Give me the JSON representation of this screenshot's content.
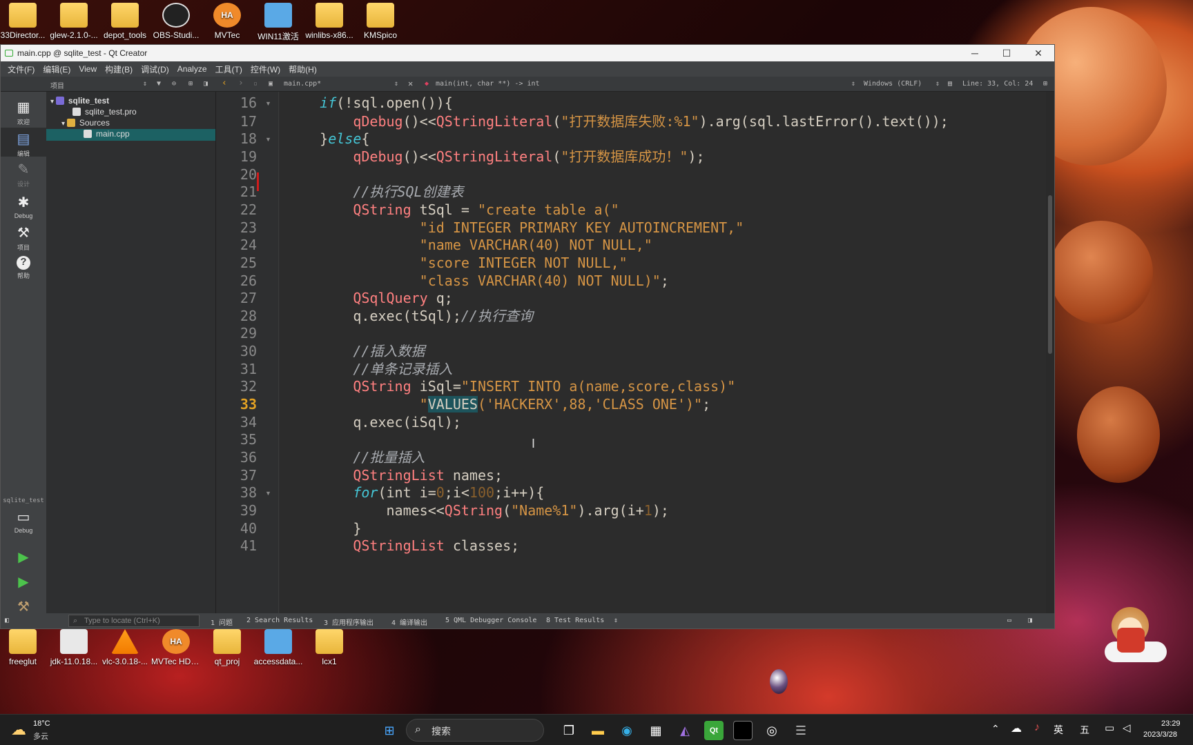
{
  "desktop": {
    "top_icons": [
      {
        "label": "33Director...",
        "icon": "folder-icon"
      },
      {
        "label": "glew-2.1.0-...",
        "icon": "zip-folder-icon"
      },
      {
        "label": "depot_tools",
        "icon": "folder-icon"
      },
      {
        "label": "OBS-Studi...",
        "icon": "obs-icon"
      },
      {
        "label": "MVTec",
        "icon": "halcon-icon",
        "badge": "HA"
      },
      {
        "label": "WIN11激活",
        "icon": "installer-icon"
      },
      {
        "label": "winlibs-x86...",
        "icon": "zip-folder-icon"
      },
      {
        "label": "KMSpico",
        "icon": "folder-icon"
      }
    ],
    "bottom_icons": [
      {
        "label": "freeglut",
        "icon": "folder-icon"
      },
      {
        "label": "jdk-11.0.18...",
        "icon": "java-icon"
      },
      {
        "label": "vlc-3.0.18-...",
        "icon": "vlc-icon"
      },
      {
        "label": "MVTec HDevel...",
        "icon": "halcon-icon",
        "badge": "HA"
      },
      {
        "label": "qt_proj",
        "icon": "folder-icon"
      },
      {
        "label": "accessdata...",
        "icon": "installer-icon"
      },
      {
        "label": "lcx1",
        "icon": "folder-icon"
      }
    ]
  },
  "window": {
    "title": "main.cpp @ sqlite_test - Qt Creator",
    "controls": {
      "minimize": "─",
      "maximize": "☐",
      "close": "✕"
    }
  },
  "menu": [
    "文件(F)",
    "编辑(E)",
    "View",
    "构建(B)",
    "调试(D)",
    "Analyze",
    "工具(T)",
    "控件(W)",
    "帮助(H)"
  ],
  "toolbar": {
    "panel_label": "项目",
    "file_tab": "main.cpp*",
    "function": "main(int, char **) -> int",
    "line_ending": "Windows (CRLF)",
    "cursor_pos": "Line: 33, Col: 24"
  },
  "modes": [
    {
      "label": "欢迎",
      "icon": "grid-icon"
    },
    {
      "label": "编辑",
      "icon": "edit-icon"
    },
    {
      "label": "设计",
      "icon": "pencil-icon"
    },
    {
      "label": "Debug",
      "icon": "bug-icon"
    },
    {
      "label": "项目",
      "icon": "wrench-icon"
    },
    {
      "label": "帮助",
      "icon": "help-icon"
    }
  ],
  "kit": {
    "project": "sqlite_test",
    "label": "Debug"
  },
  "project_tree": [
    {
      "label": "sqlite_test",
      "level": 0
    },
    {
      "label": "sqlite_test.pro",
      "level": 1
    },
    {
      "label": "Sources",
      "level": 1
    },
    {
      "label": "main.cpp",
      "level": 2,
      "selected": true
    }
  ],
  "editor": {
    "current_line": 33,
    "lines": [
      {
        "n": "16",
        "fold": true,
        "html": "    <span class='k'>if</span>(!sql.open()){"
      },
      {
        "n": "17",
        "html": "        <span class='fn'>qDebug</span>()&lt;&lt;<span class='fn'>QStringLiteral</span>(<span class='s'>\"打开数据库失败:%1\"</span>).arg(sql.lastError().text());"
      },
      {
        "n": "18",
        "fold": true,
        "html": "    }<span class='k'>else</span>{"
      },
      {
        "n": "19",
        "html": "        <span class='fn'>qDebug</span>()&lt;&lt;<span class='fn'>QStringLiteral</span>(<span class='s'>\"打开数据库成功！\"</span>);"
      },
      {
        "n": "20",
        "html": ""
      },
      {
        "n": "21",
        "html": "        <span class='c'>//执行SQL创建表</span>"
      },
      {
        "n": "22",
        "html": "        <span class='ty'>QString</span> tSql = <span class='s'>\"create table a(\"</span>"
      },
      {
        "n": "23",
        "html": "                <span class='s'>\"id INTEGER PRIMARY KEY AUTOINCREMENT,\"</span>"
      },
      {
        "n": "24",
        "html": "                <span class='s'>\"name VARCHAR(40) NOT NULL,\"</span>"
      },
      {
        "n": "25",
        "html": "                <span class='s'>\"score INTEGER NOT NULL,\"</span>"
      },
      {
        "n": "26",
        "html": "                <span class='s'>\"class VARCHAR(40) NOT NULL)\"</span>;"
      },
      {
        "n": "27",
        "html": "        <span class='ty'>QSqlQuery</span> q;"
      },
      {
        "n": "28",
        "html": "        q.exec(tSql);<span class='c'>//执行查询</span>"
      },
      {
        "n": "29",
        "html": ""
      },
      {
        "n": "30",
        "html": "        <span class='c'>//插入数据</span>"
      },
      {
        "n": "31",
        "html": "        <span class='c'>//单条记录插入</span>"
      },
      {
        "n": "32",
        "html": "        <span class='ty'>QString</span> iSql=<span class='s'>\"INSERT INTO a(name,score,class)\"</span>"
      },
      {
        "n": "33",
        "html": "                <span class='s'>\"<span class='hl'>VALUES</span>('HACKERX',88,'CLASS ONE')\"</span>;"
      },
      {
        "n": "34",
        "html": "        q.exec(iSql);"
      },
      {
        "n": "35",
        "html": ""
      },
      {
        "n": "36",
        "html": "        <span class='c'>//批量插入</span>"
      },
      {
        "n": "37",
        "html": "        <span class='ty'>QStringList</span> names;"
      },
      {
        "n": "38",
        "fold": true,
        "html": "        <span class='k'>for</span>(int i=<span class='n'>0</span>;i&lt;<span class='n'>100</span>;i++){"
      },
      {
        "n": "39",
        "html": "            names&lt;&lt;<span class='fn'>QString</span>(<span class='s'>\"Name%1\"</span>).arg(i+<span class='n'>1</span>);"
      },
      {
        "n": "40",
        "html": "        }"
      },
      {
        "n": "41",
        "html": "        <span class='ty'>QStringList</span> classes;"
      }
    ]
  },
  "statusbar": {
    "locate_placeholder": "Type to locate (Ctrl+K)",
    "panes": [
      "1 问题",
      "2 Search Results",
      "3 应用程序输出",
      "4 编译输出",
      "5 QML Debugger Console",
      "8 Test Results"
    ]
  },
  "taskbar": {
    "weather_temp": "18°C",
    "weather_desc": "多云",
    "search_label": "搜索",
    "ime": "英",
    "ime2": "五",
    "time": "23:29",
    "date": "2023/3/28"
  }
}
